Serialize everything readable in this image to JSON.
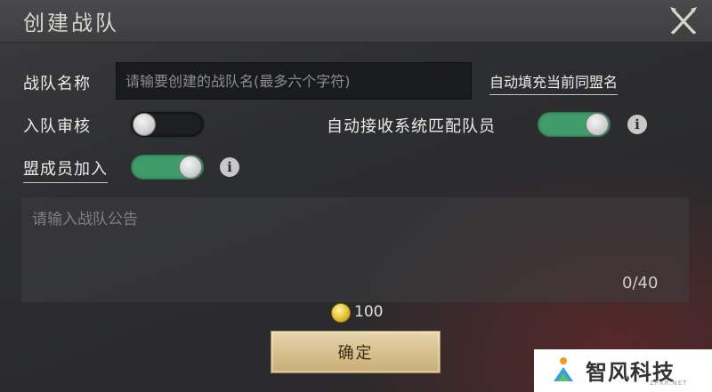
{
  "dialog": {
    "title": "创建战队",
    "close_icon": "crossed-swords-close-icon"
  },
  "team_name": {
    "label": "战队名称",
    "placeholder": "请输要创建的战队名(最多六个字符)",
    "value": "",
    "autofill_link": "自动填充当前同盟名"
  },
  "join_review": {
    "label": "入队审核",
    "enabled": false
  },
  "auto_accept": {
    "label": "自动接收系统匹配队员",
    "enabled": true,
    "info_icon": "info-icon"
  },
  "alliance_join": {
    "label": "盟成员加入",
    "enabled": true,
    "info_icon": "info-icon"
  },
  "notice": {
    "placeholder": "请输入战队公告",
    "value": "",
    "counter": "0/40"
  },
  "cost": {
    "icon": "gold-coin-icon",
    "amount": "100"
  },
  "confirm_button": {
    "label": "确定"
  },
  "watermark": {
    "text": "智风科技",
    "sub": "ZFXR.NET"
  },
  "colors": {
    "toggle_on": "#3f9c6a",
    "toggle_off": "#1e1f22",
    "confirm_bg": "#d6bf8d",
    "text": "#ecebe7"
  }
}
